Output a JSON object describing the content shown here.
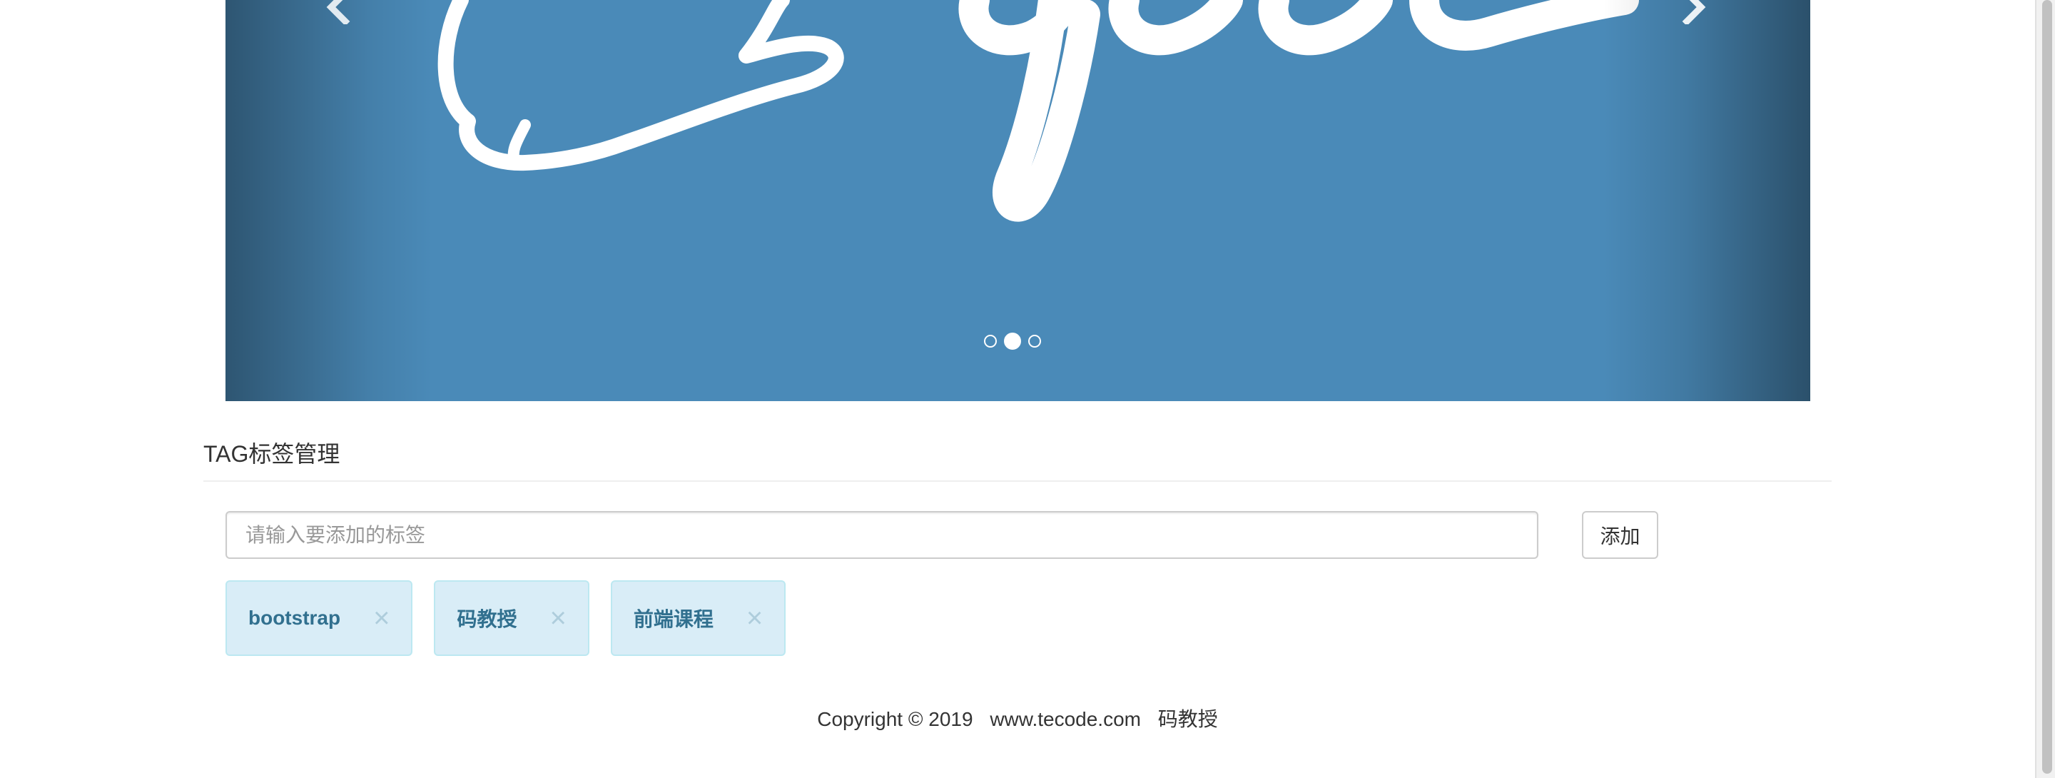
{
  "carousel": {
    "indicators": [
      {
        "active": false
      },
      {
        "active": true
      },
      {
        "active": false
      }
    ],
    "prev_icon": "chevron-left-icon",
    "next_icon": "chevron-right-icon",
    "background_color": "#4a8ab8"
  },
  "section": {
    "title": "TAG标签管理"
  },
  "tag_input": {
    "placeholder": "请输入要添加的标签",
    "value": ""
  },
  "add_button": {
    "label": "添加"
  },
  "tags": [
    {
      "label": "bootstrap",
      "close": "×"
    },
    {
      "label": "码教授",
      "close": "×"
    },
    {
      "label": "前端课程",
      "close": "×"
    }
  ],
  "footer": {
    "copyright": "Copyright © 2019",
    "site": "www.tecode.com",
    "brand": "码教授"
  },
  "colors": {
    "tag_background": "#d9edf7",
    "tag_text": "#31708f",
    "tag_border": "#bce8f1"
  }
}
